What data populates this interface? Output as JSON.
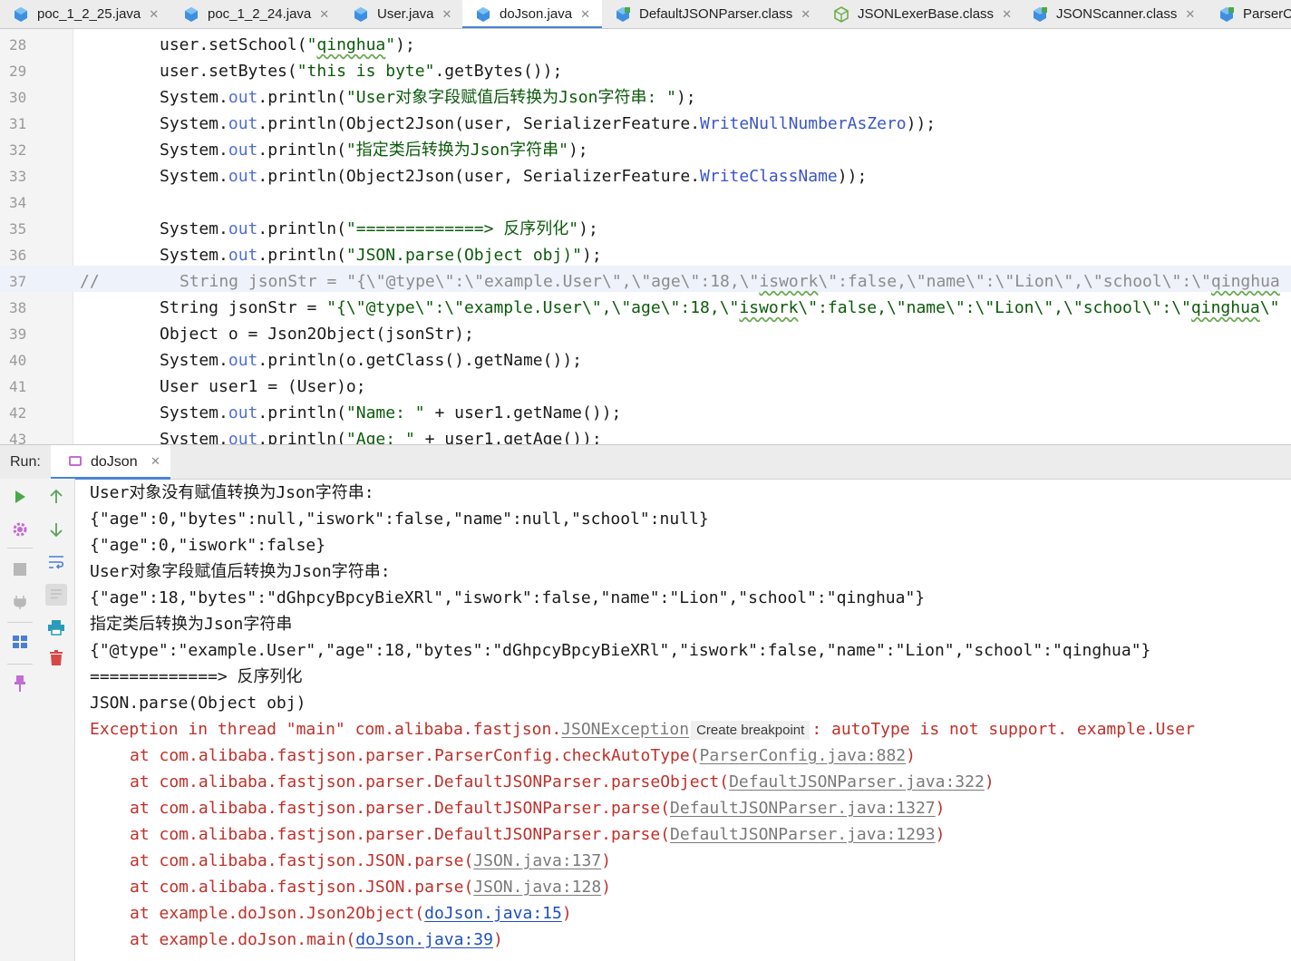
{
  "tabs": [
    {
      "label": "poc_1_2_25.java",
      "icon": "java-class-icon",
      "closable": true
    },
    {
      "label": "poc_1_2_24.java",
      "icon": "java-class-icon",
      "closable": true
    },
    {
      "label": "User.java",
      "icon": "java-class-icon",
      "closable": true
    },
    {
      "label": "doJson.java",
      "icon": "java-class-icon",
      "closable": true,
      "active": true
    },
    {
      "label": "DefaultJSONParser.class",
      "icon": "compiled-class-icon",
      "closable": true
    },
    {
      "label": "JSONLexerBase.class",
      "icon": "abstract-class-icon",
      "closable": true
    },
    {
      "label": "JSONScanner.class",
      "icon": "compiled-class-icon",
      "closable": true
    },
    {
      "label": "ParserC",
      "icon": "compiled-class-icon",
      "closable": false
    }
  ],
  "editor": {
    "current_line": 37,
    "lines": [
      {
        "n": "28",
        "parts": [
          {
            "t": "user.setSchool("
          },
          {
            "t": "\"",
            "c": "str"
          },
          {
            "t": "qinghua",
            "c": "str typo"
          },
          {
            "t": "\"",
            "c": "str"
          },
          {
            "t": ");"
          }
        ]
      },
      {
        "n": "29",
        "parts": [
          {
            "t": "user.setBytes("
          },
          {
            "t": "\"this is byte\"",
            "c": "str"
          },
          {
            "t": ".getBytes());"
          }
        ]
      },
      {
        "n": "30",
        "parts": [
          {
            "t": "System."
          },
          {
            "t": "out",
            "c": "fld"
          },
          {
            "t": ".println("
          },
          {
            "t": "\"User对象字段赋值后转换为Json字符串: \"",
            "c": "str"
          },
          {
            "t": ");"
          }
        ]
      },
      {
        "n": "31",
        "parts": [
          {
            "t": "System."
          },
          {
            "t": "out",
            "c": "fld"
          },
          {
            "t": ".println(Object2Json(user, SerializerFeature."
          },
          {
            "t": "WriteNullNumberAsZero",
            "c": "fld2"
          },
          {
            "t": "));"
          }
        ]
      },
      {
        "n": "32",
        "parts": [
          {
            "t": "System."
          },
          {
            "t": "out",
            "c": "fld"
          },
          {
            "t": ".println("
          },
          {
            "t": "\"指定类后转换为Json字符串\"",
            "c": "str"
          },
          {
            "t": ");"
          }
        ]
      },
      {
        "n": "33",
        "parts": [
          {
            "t": "System."
          },
          {
            "t": "out",
            "c": "fld"
          },
          {
            "t": ".println(Object2Json(user, SerializerFeature."
          },
          {
            "t": "WriteClassName",
            "c": "fld2"
          },
          {
            "t": "));"
          }
        ]
      },
      {
        "n": "34",
        "parts": []
      },
      {
        "n": "35",
        "parts": [
          {
            "t": "System."
          },
          {
            "t": "out",
            "c": "fld"
          },
          {
            "t": ".println("
          },
          {
            "t": "\"=============> 反序列化\"",
            "c": "str"
          },
          {
            "t": ");"
          }
        ]
      },
      {
        "n": "36",
        "parts": [
          {
            "t": "System."
          },
          {
            "t": "out",
            "c": "fld"
          },
          {
            "t": ".println("
          },
          {
            "t": "\"JSON.parse(Object obj)\"",
            "c": "str"
          },
          {
            "t": ");"
          }
        ]
      },
      {
        "n": "37",
        "comment": true,
        "slash": "//",
        "parts": [
          {
            "t": "String jsonStr = \"{\\\"@type\\\":\\\"example.User\\\",\\\"age\\\":18,\\\""
          },
          {
            "t": "iswork",
            "c": "typo"
          },
          {
            "t": "\\\":false,\\\"name\\\":\\\"Lion\\\",\\\"school\\\":\\\""
          },
          {
            "t": "qinghua",
            "c": "typo"
          }
        ]
      },
      {
        "n": "38",
        "parts": [
          {
            "t": "String jsonStr = "
          },
          {
            "t": "\"{\\\"@type\\\":\\\"example.User\\\",\\\"age\\\":18,\\\"",
            "c": "str"
          },
          {
            "t": "iswork",
            "c": "str typo"
          },
          {
            "t": "\\\":false,\\\"name\\\":\\\"Lion\\\",\\\"school\\\":\\\"",
            "c": "str"
          },
          {
            "t": "qinghua",
            "c": "str typo"
          },
          {
            "t": "\\\"",
            "c": "str"
          }
        ]
      },
      {
        "n": "39",
        "parts": [
          {
            "t": "Object o = Json2Object(jsonStr);"
          }
        ]
      },
      {
        "n": "40",
        "parts": [
          {
            "t": "System."
          },
          {
            "t": "out",
            "c": "fld"
          },
          {
            "t": ".println(o.getClass().getName());"
          }
        ]
      },
      {
        "n": "41",
        "parts": [
          {
            "t": "User user1 = (User)o;"
          }
        ]
      },
      {
        "n": "42",
        "parts": [
          {
            "t": "System."
          },
          {
            "t": "out",
            "c": "fld"
          },
          {
            "t": ".println("
          },
          {
            "t": "\"Name: \"",
            "c": "str"
          },
          {
            "t": " + user1.getName());"
          }
        ]
      },
      {
        "n": "43",
        "parts": [
          {
            "t": "System."
          },
          {
            "t": "out",
            "c": "fld"
          },
          {
            "t": ".println("
          },
          {
            "t": "\"Age: \"",
            "c": "str"
          },
          {
            "t": " + user1.getAge());"
          }
        ]
      }
    ]
  },
  "run_panel": {
    "label": "Run:",
    "tab_label": "doJson"
  },
  "console": {
    "lines": [
      {
        "kind": "out",
        "parts": [
          {
            "t": "User对象没有赋值转换为Json字符串:"
          }
        ]
      },
      {
        "kind": "out",
        "parts": [
          {
            "t": "{\"age\":0,\"bytes\":null,\"iswork\":false,\"name\":null,\"school\":null}"
          }
        ]
      },
      {
        "kind": "out",
        "parts": [
          {
            "t": "{\"age\":0,\"iswork\":false}"
          }
        ]
      },
      {
        "kind": "out",
        "parts": [
          {
            "t": "User对象字段赋值后转换为Json字符串:"
          }
        ]
      },
      {
        "kind": "out",
        "parts": [
          {
            "t": "{\"age\":18,\"bytes\":\"dGhpcyBpcyBieXRl\",\"iswork\":false,\"name\":\"Lion\",\"school\":\"qinghua\"}"
          }
        ]
      },
      {
        "kind": "out",
        "parts": [
          {
            "t": "指定类后转换为Json字符串"
          }
        ]
      },
      {
        "kind": "out",
        "parts": [
          {
            "t": "{\"@type\":\"example.User\",\"age\":18,\"bytes\":\"dGhpcyBpcyBieXRl\",\"iswork\":false,\"name\":\"Lion\",\"school\":\"qinghua\"}"
          }
        ]
      },
      {
        "kind": "out",
        "parts": [
          {
            "t": "=============> 反序列化"
          }
        ]
      },
      {
        "kind": "out",
        "parts": [
          {
            "t": "JSON.parse(Object obj)"
          }
        ]
      },
      {
        "kind": "err",
        "parts": [
          {
            "t": "Exception in thread \"main\" com.alibaba.fastjson."
          },
          {
            "t": "JSONException",
            "c": "link-gray"
          },
          {
            "t": "Create breakpoint",
            "c": "bp-hint"
          },
          {
            "t": ": autoType is not support. example.User"
          }
        ]
      },
      {
        "kind": "err",
        "indent": true,
        "parts": [
          {
            "t": "at com.alibaba.fastjson.parser.ParserConfig.checkAutoType("
          },
          {
            "t": "ParserConfig.java:882",
            "c": "link-gray"
          },
          {
            "t": ")"
          }
        ]
      },
      {
        "kind": "err",
        "indent": true,
        "parts": [
          {
            "t": "at com.alibaba.fastjson.parser.DefaultJSONParser.parseObject("
          },
          {
            "t": "DefaultJSONParser.java:322",
            "c": "link-gray"
          },
          {
            "t": ")"
          }
        ]
      },
      {
        "kind": "err",
        "indent": true,
        "parts": [
          {
            "t": "at com.alibaba.fastjson.parser.DefaultJSONParser.parse("
          },
          {
            "t": "DefaultJSONParser.java:1327",
            "c": "link-gray"
          },
          {
            "t": ")"
          }
        ]
      },
      {
        "kind": "err",
        "indent": true,
        "parts": [
          {
            "t": "at com.alibaba.fastjson.parser.DefaultJSONParser.parse("
          },
          {
            "t": "DefaultJSONParser.java:1293",
            "c": "link-gray"
          },
          {
            "t": ")"
          }
        ]
      },
      {
        "kind": "err",
        "indent": true,
        "parts": [
          {
            "t": "at com.alibaba.fastjson.JSON.parse("
          },
          {
            "t": "JSON.java:137",
            "c": "link-gray"
          },
          {
            "t": ")"
          }
        ]
      },
      {
        "kind": "err",
        "indent": true,
        "parts": [
          {
            "t": "at com.alibaba.fastjson.JSON.parse("
          },
          {
            "t": "JSON.java:128",
            "c": "link-gray"
          },
          {
            "t": ")"
          }
        ]
      },
      {
        "kind": "err",
        "indent": true,
        "parts": [
          {
            "t": "at example.doJson.Json2Object("
          },
          {
            "t": "doJson.java:15",
            "c": "link-blue"
          },
          {
            "t": ")"
          }
        ]
      },
      {
        "kind": "err",
        "indent": true,
        "parts": [
          {
            "t": "at example.doJson.main("
          },
          {
            "t": "doJson.java:39",
            "c": "link-blue"
          },
          {
            "t": ")"
          }
        ]
      }
    ]
  },
  "toolbar": [
    {
      "name": "rerun-icon",
      "color": "#4aa84a"
    },
    {
      "name": "settings-icon",
      "color": "#c36dd2"
    },
    {
      "name": "stop-icon",
      "color": "#b8b8b8"
    },
    {
      "name": "plug-icon",
      "color": "#b8b8b8"
    },
    {
      "name": "layout-icon",
      "color": "#4a7ed4"
    },
    {
      "name": "pin-icon",
      "color": "#c36dd2"
    },
    {
      "name": "up-arrow-icon",
      "color": "#5aa35a"
    },
    {
      "name": "down-arrow-icon",
      "color": "#5aa35a"
    },
    {
      "name": "soft-wrap-icon",
      "color": "#4a7ed4"
    },
    {
      "name": "scroll-to-end-icon",
      "color": "#4a7ed4"
    },
    {
      "name": "print-icon",
      "color": "#2a9bb8"
    },
    {
      "name": "trash-icon",
      "color": "#d94848"
    }
  ]
}
